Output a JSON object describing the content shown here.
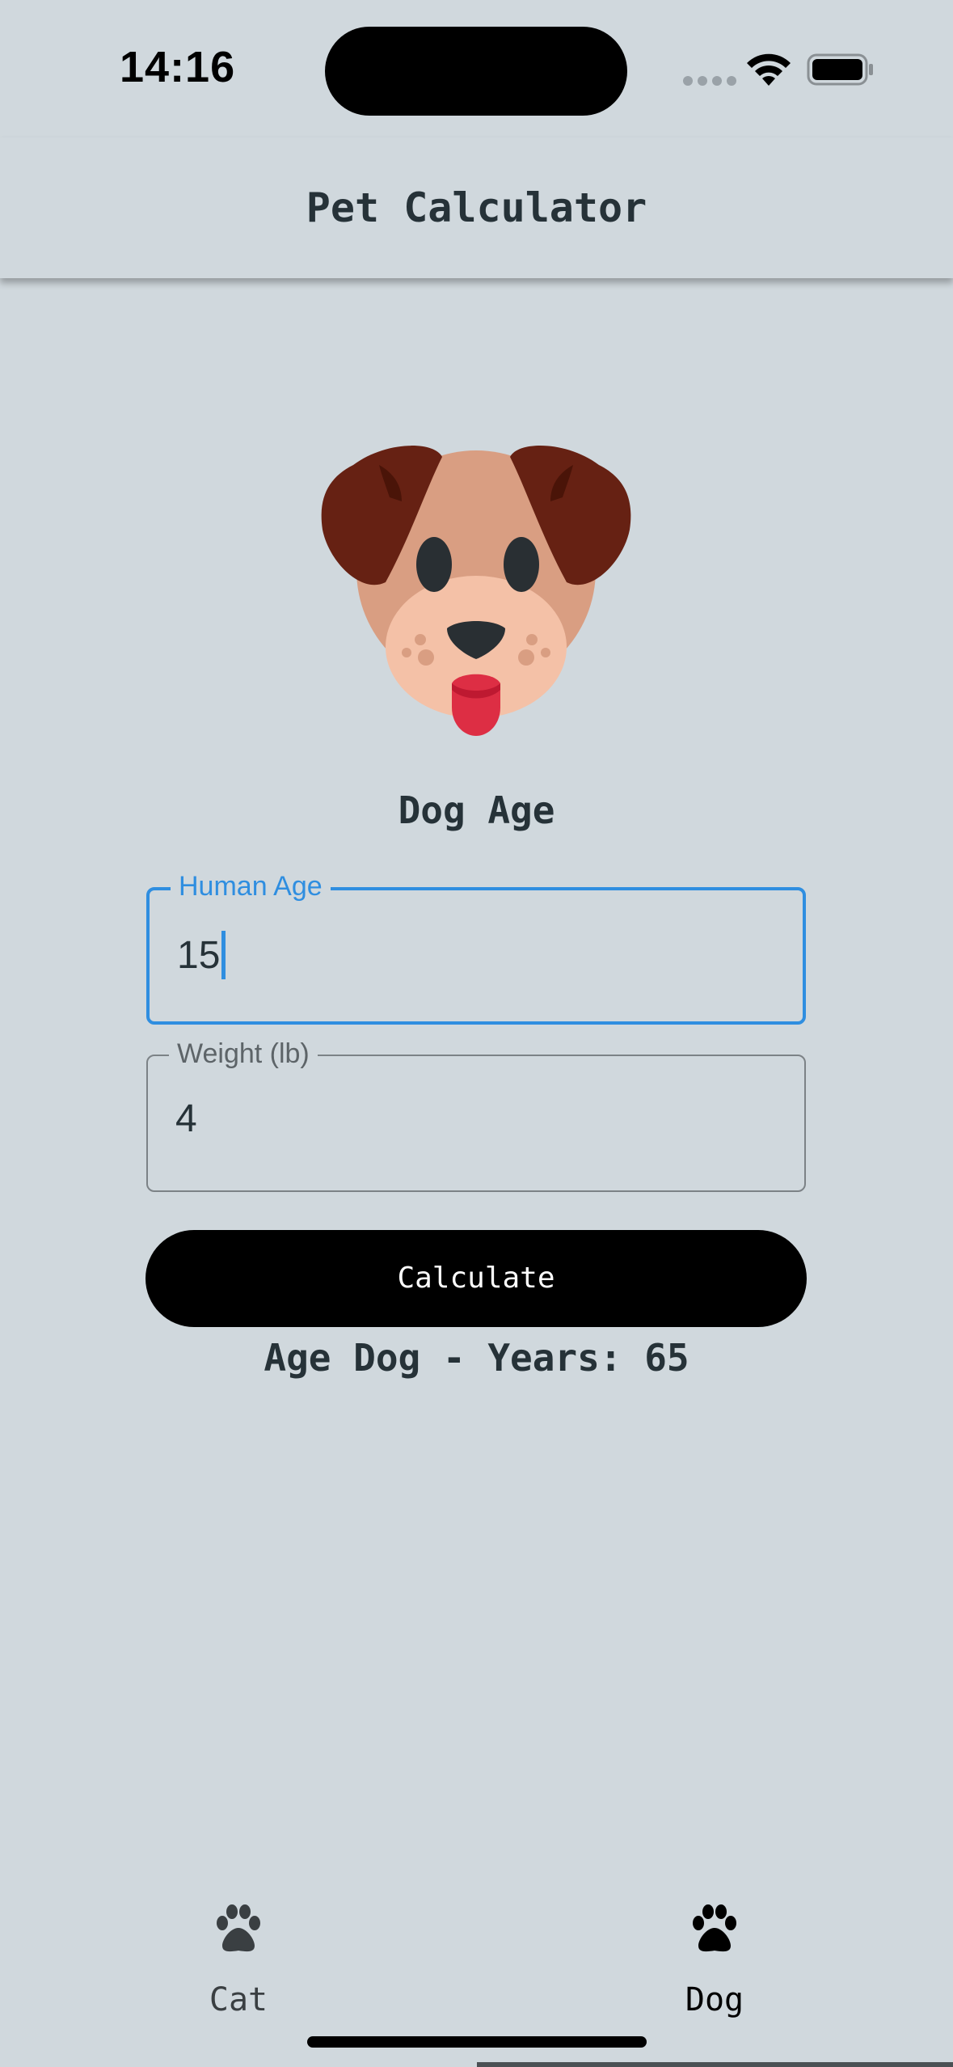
{
  "status_bar": {
    "time": "14:16",
    "wifi_icon": "wifi-icon",
    "battery_icon": "battery-icon"
  },
  "app_bar": {
    "title": "Pet Calculator"
  },
  "main": {
    "image_icon": "dog-face-icon",
    "section_title": "Dog Age",
    "human_age_field": {
      "label": "Human Age",
      "value": "15",
      "focused": true
    },
    "weight_field": {
      "label": "Weight (lb)",
      "value": "4"
    },
    "calculate_button": "Calculate",
    "result": "Age Dog - Years: 65"
  },
  "bottom_nav": {
    "items": [
      {
        "label": "Cat",
        "icon": "paw-icon",
        "selected": false
      },
      {
        "label": "Dog",
        "icon": "paw-icon",
        "selected": true
      }
    ]
  },
  "colors": {
    "background": "#d0d8dd",
    "accent": "#2f8ee0",
    "button": "#000000",
    "text": "#263238"
  }
}
